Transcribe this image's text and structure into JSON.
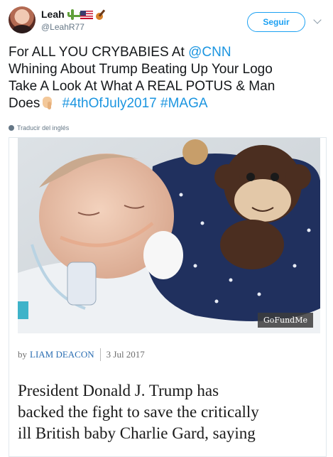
{
  "user": {
    "display_name": "Leah",
    "emojis": [
      "cactus-icon",
      "us-flag-icon",
      "guitar-icon"
    ],
    "handle": "@LeahR77"
  },
  "follow_button": "Seguir",
  "tweet": {
    "line1_text": "For ALL YOU CRYBABIES At ",
    "line1_mention": "@CNN",
    "line2": "Whining About Trump Beating Up Your Logo",
    "line3": "Take A Look At What A REAL POTUS & Man",
    "line4_text": "Does",
    "hashtag1": "#4thOfJuly2017",
    "hashtag2": "#MAGA"
  },
  "translate_label": "Traducir del inglés",
  "card": {
    "photo_watermark": "GoFundMe",
    "by_label": "by",
    "author": "LIAM DEACON",
    "date": "3 Jul 2017",
    "headline_lines": [
      "President Donald J. Trump has",
      "backed the fight to save the critically",
      "ill British baby Charlie Gard, saying"
    ]
  },
  "colors": {
    "link": "#1b95e0",
    "follow_border": "#1da1f2",
    "author_link": "#2a6db2"
  }
}
